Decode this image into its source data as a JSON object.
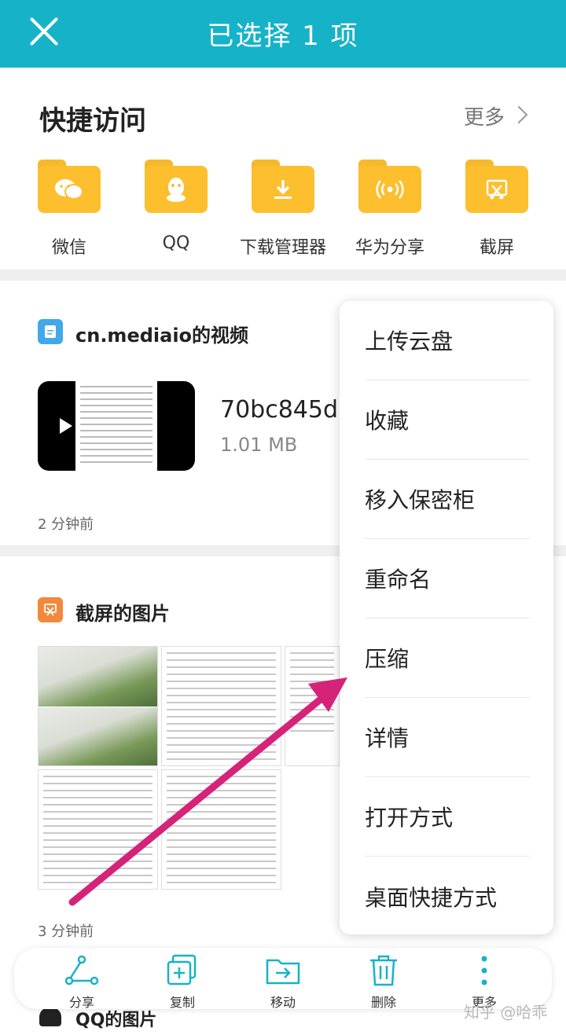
{
  "topbar": {
    "title": "已选择 1 项"
  },
  "quick_access": {
    "title": "快捷访问",
    "more": "更多",
    "items": [
      {
        "label": "微信",
        "icon": "wechat-icon"
      },
      {
        "label": "QQ",
        "icon": "qq-icon"
      },
      {
        "label": "下载管理器",
        "icon": "download-icon"
      },
      {
        "label": "华为分享",
        "icon": "share-signal-icon"
      },
      {
        "label": "截屏",
        "icon": "screenshot-icon"
      }
    ]
  },
  "video_section": {
    "title": "cn.mediaio的视频",
    "file_name": "70bc845d.",
    "file_size": "1.01 MB",
    "time": "2 分钟前"
  },
  "screenshot_section": {
    "title": "截屏的图片",
    "time": "3 分钟前"
  },
  "context_menu": {
    "items": [
      "上传云盘",
      "收藏",
      "移入保密柜",
      "重命名",
      "压缩",
      "详情",
      "打开方式",
      "桌面快捷方式"
    ]
  },
  "bottom_bar": {
    "items": [
      {
        "label": "分享",
        "icon": "share-icon"
      },
      {
        "label": "复制",
        "icon": "copy-icon"
      },
      {
        "label": "移动",
        "icon": "move-icon"
      },
      {
        "label": "删除",
        "icon": "delete-icon"
      },
      {
        "label": "更多",
        "icon": "more-icon"
      }
    ]
  },
  "qq_section": {
    "title": "QQ的图片"
  },
  "watermark": "知乎 @哈乖",
  "colors": {
    "accent": "#16b3c8",
    "folder": "#fdbf2e",
    "arrow": "#d6237a"
  }
}
